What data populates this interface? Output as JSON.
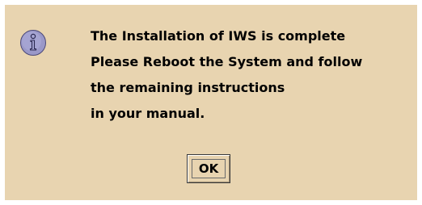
{
  "dialog": {
    "icon": "info-icon",
    "message_lines": [
      "The Installation of IWS is complete",
      "Please Reboot the System and follow",
      "the remaining instructions",
      "in your manual."
    ],
    "ok_label": "OK"
  },
  "colors": {
    "dialog_background": "#e8d4b0",
    "icon_fill": "#9a98c8",
    "icon_stroke": "#4a4878",
    "text": "#000000"
  }
}
